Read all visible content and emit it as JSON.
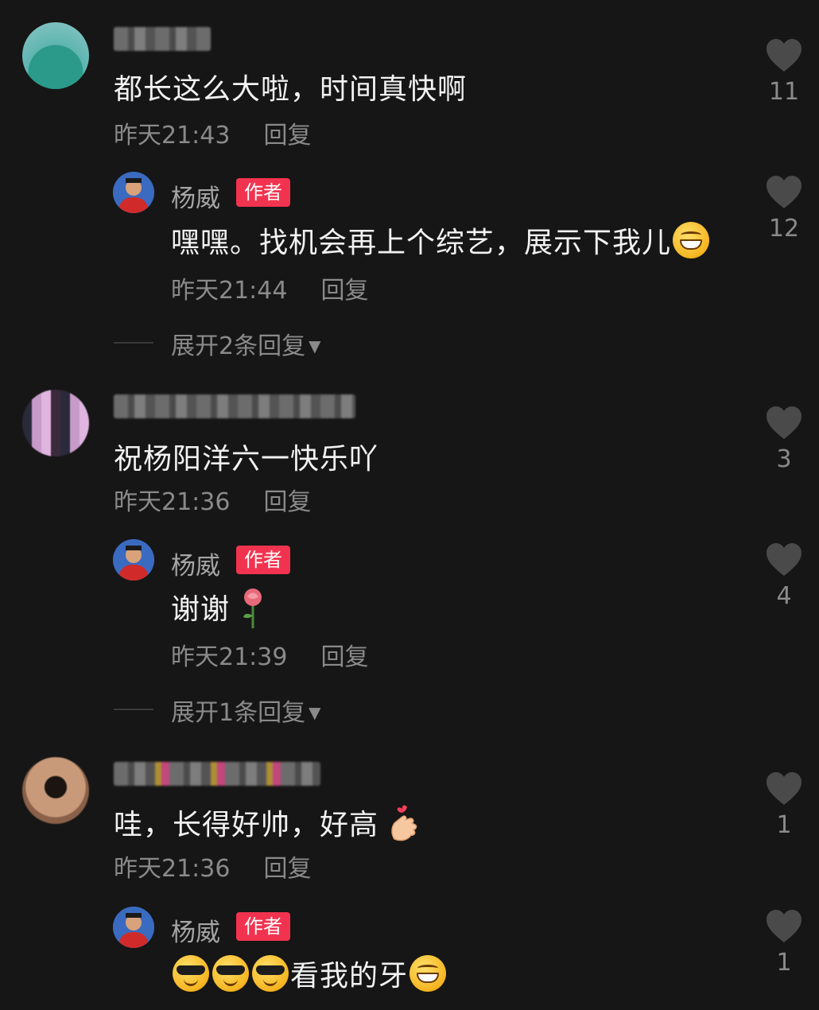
{
  "comments": [
    {
      "text": "都长这么大啦，时间真快啊",
      "time": "昨天21:43",
      "reply_label": "回复",
      "likes": "11",
      "reply": {
        "author": "杨威",
        "badge": "作者",
        "text": "嘿嘿。找机会再上个综艺，展示下我儿",
        "emoji": "grin-emoji",
        "time": "昨天21:44",
        "reply_label": "回复",
        "likes": "12"
      },
      "expand": "展开2条回复"
    },
    {
      "text": "祝杨阳洋六一快乐吖",
      "time": "昨天21:36",
      "reply_label": "回复",
      "likes": "3",
      "reply": {
        "author": "杨威",
        "badge": "作者",
        "text": "谢谢",
        "emoji": "rose-emoji",
        "time": "昨天21:39",
        "reply_label": "回复",
        "likes": "4"
      },
      "expand": "展开1条回复"
    },
    {
      "text": "哇，长得好帅，好高",
      "emoji": "finger-heart-emoji",
      "time": "昨天21:36",
      "reply_label": "回复",
      "likes": "1",
      "reply": {
        "author": "杨威",
        "badge": "作者",
        "text": "看我的牙",
        "emoji": "sunglasses-emoji, grin-emoji",
        "likes": "1"
      }
    }
  ],
  "colors": {
    "background": "#161616",
    "badge": "#f2334f",
    "muted": "#8a8a8a"
  }
}
